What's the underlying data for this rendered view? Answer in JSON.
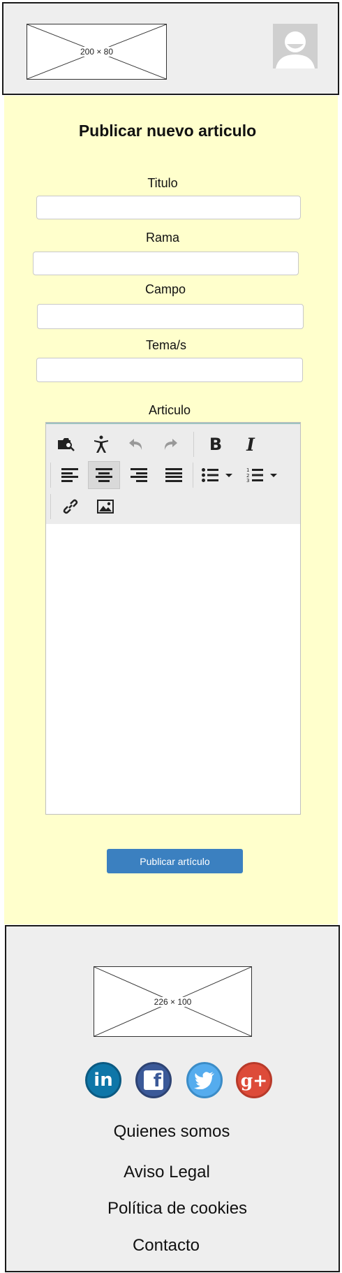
{
  "header": {
    "logo_text": "200 × 80",
    "avatar_icon": "user-avatar-icon"
  },
  "form": {
    "title": "Publicar nuevo articulo",
    "titulo_label": "Titulo",
    "rama_label": "Rama",
    "campo_label": "Campo",
    "temas_label": "Tema/s",
    "articulo_label": "Articulo",
    "submit_label": "Publicar artículo"
  },
  "editor": {
    "toolbar_icons": [
      "preview-icon",
      "accessibility-icon",
      "undo-icon",
      "redo-icon",
      "bold-icon",
      "italic-icon",
      "align-left-icon",
      "align-center-icon",
      "align-right-icon",
      "align-justify-icon",
      "bullet-list-icon",
      "numbered-list-icon",
      "link-icon",
      "image-icon"
    ],
    "bold_glyph": "B",
    "italic_glyph": "I"
  },
  "footer": {
    "logo_text": "226 × 100",
    "social": {
      "linkedin": "in",
      "facebook": "f",
      "twitter_icon": "twitter-bird-icon",
      "googleplus": "g+"
    },
    "links": [
      "Quienes somos",
      "Aviso Legal",
      "Política de cookies",
      "Contacto"
    ]
  },
  "colors": {
    "header_bg": "#eeeeee",
    "main_bg": "#ffffcc",
    "button": "#3b80c0",
    "linkedin": "#0e76a8",
    "facebook": "#3b5998",
    "twitter": "#55acee",
    "googleplus": "#dd4b39"
  }
}
